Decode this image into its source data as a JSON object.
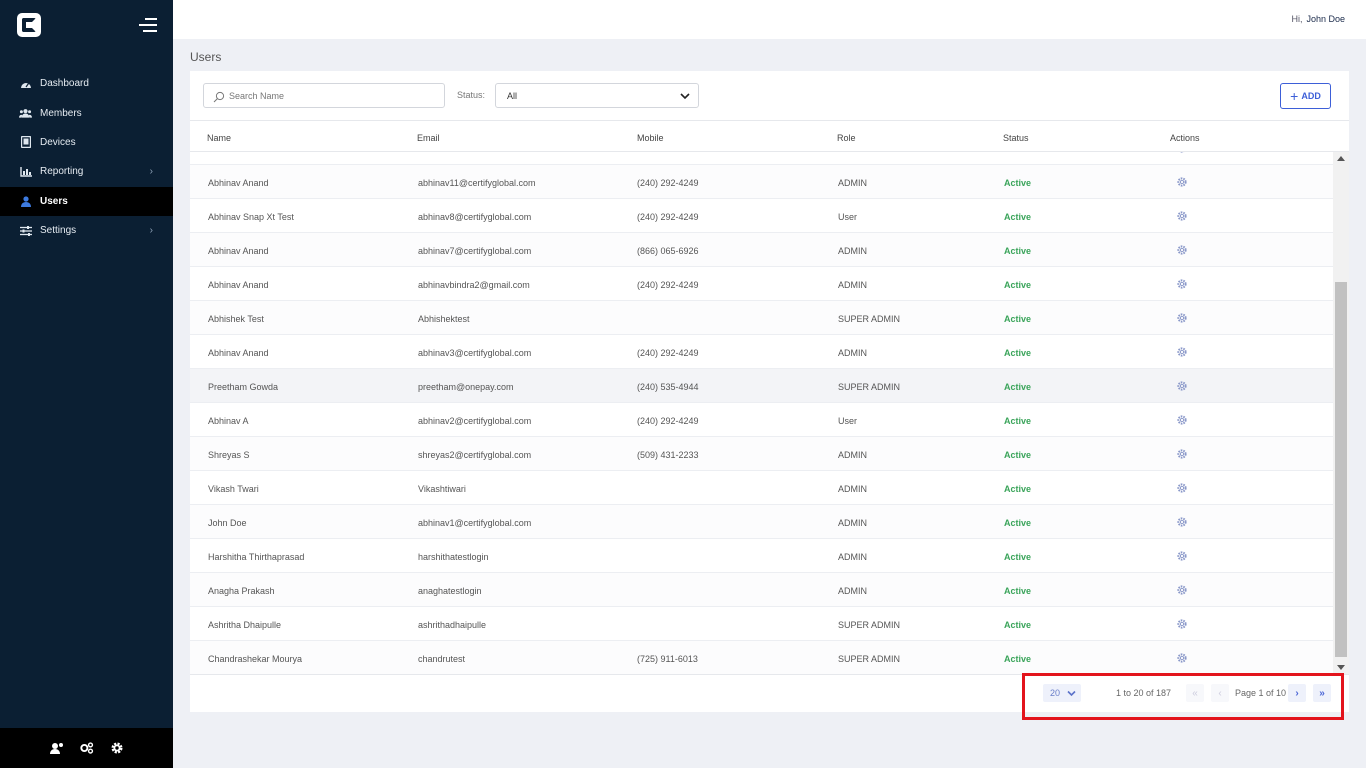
{
  "sidebar": {
    "items": [
      {
        "label": "Dashboard",
        "icon": "dashboard-icon",
        "chevron": false,
        "active": false
      },
      {
        "label": "Members",
        "icon": "members-icon",
        "chevron": false,
        "active": false
      },
      {
        "label": "Devices",
        "icon": "devices-icon",
        "chevron": false,
        "active": false
      },
      {
        "label": "Reporting",
        "icon": "reporting-icon",
        "chevron": true,
        "active": false
      },
      {
        "label": "Users",
        "icon": "user-icon",
        "chevron": false,
        "active": true
      },
      {
        "label": "Settings",
        "icon": "settings-icon",
        "chevron": true,
        "active": false
      }
    ],
    "chevron_glyph": "›"
  },
  "header": {
    "greeting": "Hi,",
    "user_name": "John Doe"
  },
  "page": {
    "title": "Users"
  },
  "toolbar": {
    "search_placeholder": "Search Name",
    "status_label": "Status:",
    "status_value": "All",
    "add_label": "ADD",
    "add_plus": "+"
  },
  "table": {
    "columns": [
      "Name",
      "Email",
      "Mobile",
      "Role",
      "Status",
      "Actions"
    ],
    "rows": [
      {
        "name": "Abhinav Anand",
        "email": "abhinav11@certifyglobal.com",
        "mobile": "(240) 292-4249",
        "role": "ADMIN",
        "status": "Active"
      },
      {
        "name": "Abhinav Snap Xt Test",
        "email": "abhinav8@certifyglobal.com",
        "mobile": "(240) 292-4249",
        "role": "User",
        "status": "Active"
      },
      {
        "name": "Abhinav Anand",
        "email": "abhinav7@certifyglobal.com",
        "mobile": "(866) 065-6926",
        "role": "ADMIN",
        "status": "Active"
      },
      {
        "name": "Abhinav Anand",
        "email": "abhinavbindra2@gmail.com",
        "mobile": "(240) 292-4249",
        "role": "ADMIN",
        "status": "Active"
      },
      {
        "name": "Abhishek Test",
        "email": "Abhishektest",
        "mobile": "",
        "role": "SUPER ADMIN",
        "status": "Active"
      },
      {
        "name": "Abhinav Anand",
        "email": "abhinav3@certifyglobal.com",
        "mobile": "(240) 292-4249",
        "role": "ADMIN",
        "status": "Active"
      },
      {
        "name": "Preetham Gowda",
        "email": "preetham@onepay.com",
        "mobile": "(240) 535-4944",
        "role": "SUPER ADMIN",
        "status": "Active"
      },
      {
        "name": "Abhinav A",
        "email": "abhinav2@certifyglobal.com",
        "mobile": "(240) 292-4249",
        "role": "User",
        "status": "Active"
      },
      {
        "name": "Shreyas S",
        "email": "shreyas2@certifyglobal.com",
        "mobile": "(509) 431-2233",
        "role": "ADMIN",
        "status": "Active"
      },
      {
        "name": "Vikash Twari",
        "email": "Vikashtiwari",
        "mobile": "",
        "role": "ADMIN",
        "status": "Active"
      },
      {
        "name": "John Doe",
        "email": "abhinav1@certifyglobal.com",
        "mobile": "",
        "role": "ADMIN",
        "status": "Active"
      },
      {
        "name": "Harshitha Thirthaprasad",
        "email": "harshithatestlogin",
        "mobile": "",
        "role": "ADMIN",
        "status": "Active"
      },
      {
        "name": "Anagha Prakash",
        "email": "anaghatestlogin",
        "mobile": "",
        "role": "ADMIN",
        "status": "Active"
      },
      {
        "name": "Ashritha Dhaipulle",
        "email": "ashrithadhaipulle",
        "mobile": "",
        "role": "SUPER ADMIN",
        "status": "Active"
      },
      {
        "name": "Chandrashekar Mourya",
        "email": "chandrutest",
        "mobile": "(725) 911-6013",
        "role": "SUPER ADMIN",
        "status": "Active"
      }
    ],
    "highlighted_row": 6
  },
  "pagination": {
    "page_size": "20",
    "range_text": "1 to 20 of 187",
    "page_text": "Page 1 of 10",
    "first_glyph": "«",
    "prev_glyph": "‹",
    "next_glyph": "›",
    "last_glyph": "»"
  },
  "colors": {
    "sidebar_bg": "#0b1f33",
    "accent": "#3d5fd8",
    "status_active": "#3aa45a",
    "annotation_box": "#e3141c"
  }
}
